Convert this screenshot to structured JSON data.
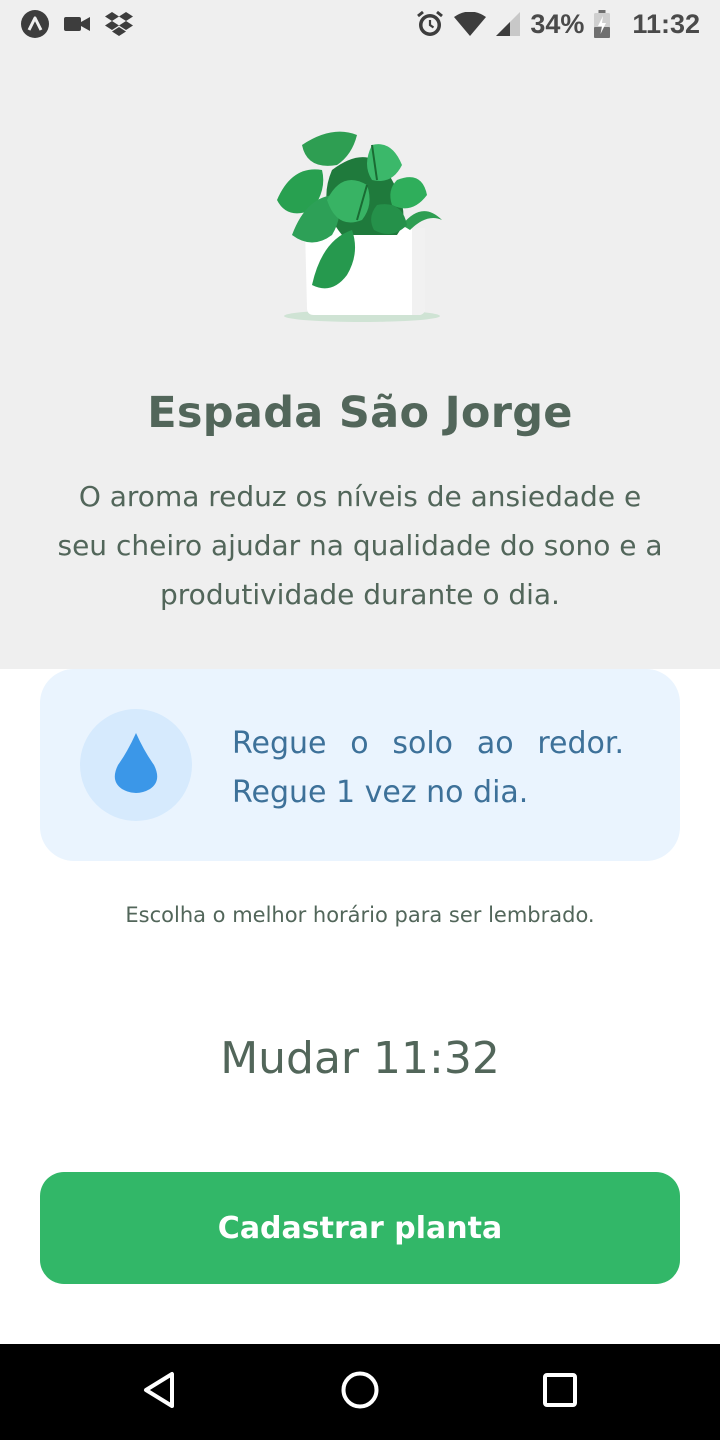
{
  "status_bar": {
    "battery_percent": "34%",
    "time": "11:32",
    "left_icons": [
      "app-logo-icon",
      "video-camera-icon",
      "dropbox-icon"
    ],
    "right_icons": [
      "alarm-icon",
      "wifi-icon",
      "cellular-signal-icon",
      "battery-charging-icon"
    ]
  },
  "plant": {
    "name": "Espada São Jorge",
    "about": "O aroma reduz os níveis de ansiedade e seu cheiro ajudar na qualidade do sono e a produtividade durante o dia.",
    "illustration": "potted-plant-illustration"
  },
  "tip": {
    "icon": "water-drop-icon",
    "line1_words": [
      "Regue",
      "o",
      "solo",
      "ao",
      "redor."
    ],
    "line2": "Regue 1 vez no dia."
  },
  "alert_label": "Escolha o melhor horário para ser lembrado.",
  "change_time_button": "Mudar 11:32",
  "primary_button": "Cadastrar planta",
  "nav_bar": {
    "buttons": [
      "back-icon",
      "home-icon",
      "recents-icon"
    ]
  },
  "colors": {
    "heading": "#52665a",
    "green": "#32b768",
    "blue_text": "#3d7199",
    "blue_light": "#eaf4fe",
    "background_gray": "#efefef"
  }
}
